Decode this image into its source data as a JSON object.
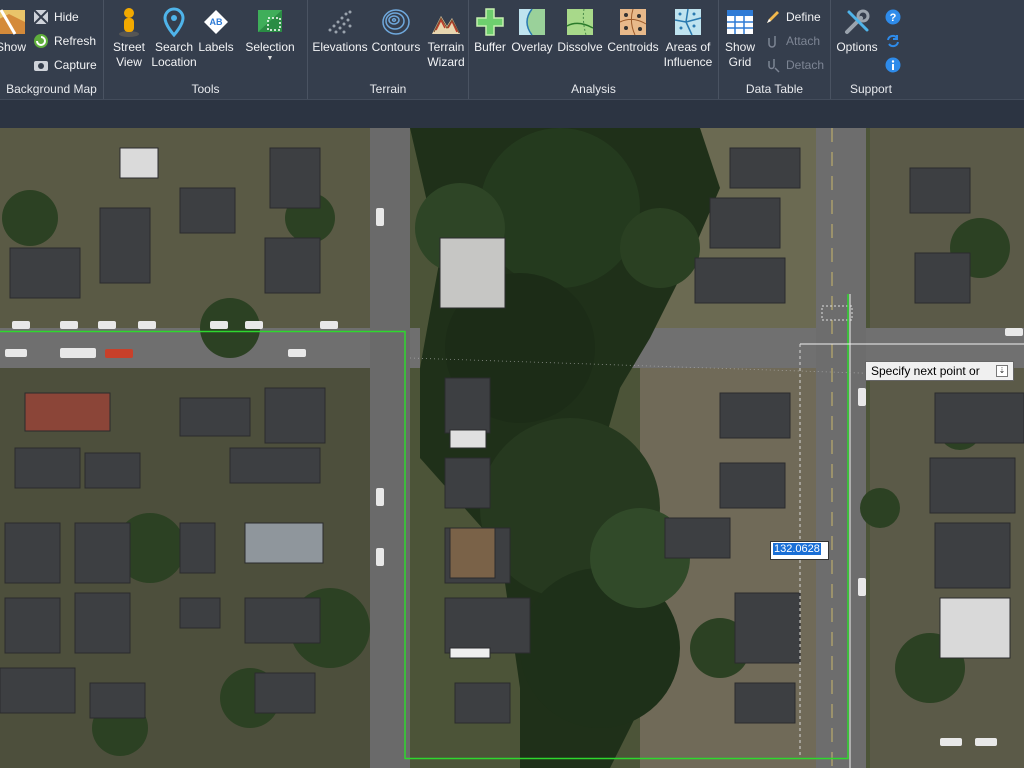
{
  "ribbon": {
    "groups": {
      "background_map": {
        "label": "Background Map",
        "show": "Show",
        "hide": "Hide",
        "refresh": "Refresh",
        "capture": "Capture"
      },
      "tools": {
        "label": "Tools",
        "street_view": [
          "Street",
          "View"
        ],
        "search_location": [
          "Search",
          "Location"
        ],
        "labels": "Labels",
        "selection": "Selection"
      },
      "terrain": {
        "label": "Terrain",
        "elevations": "Elevations",
        "contours": "Contours",
        "terrain_wizard": [
          "Terrain",
          "Wizard"
        ]
      },
      "analysis": {
        "label": "Analysis",
        "buffer": "Buffer",
        "overlay": "Overlay",
        "dissolve": "Dissolve",
        "centroids": "Centroids",
        "areas_of_influence": [
          "Areas of",
          "Influence"
        ]
      },
      "data_table": {
        "label": "Data Table",
        "show_grid": [
          "Show",
          "Grid"
        ],
        "define": "Define",
        "attach": "Attach",
        "detach": "Detach"
      },
      "support": {
        "label": "Support",
        "options": "Options"
      }
    }
  },
  "canvas": {
    "prompt_tooltip": "Specify next point or",
    "dynamic_input_value": "132.0628"
  },
  "colors": {
    "ribbon_bg": "#353e4d",
    "selection_line": "#2ed82e",
    "highlight": "#1a6fd6"
  }
}
